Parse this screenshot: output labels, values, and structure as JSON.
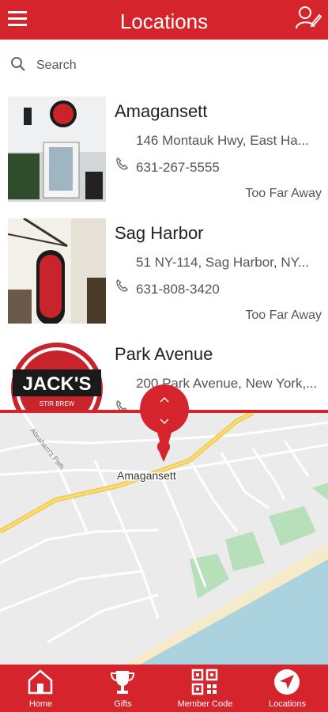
{
  "header": {
    "title": "Locations"
  },
  "search": {
    "placeholder": "Search"
  },
  "locations": [
    {
      "name": "Amagansett",
      "address": "146 Montauk Hwy, East Ha...",
      "phone": "631-267-5555",
      "distance": "Too Far Away"
    },
    {
      "name": "Sag Harbor",
      "address": "51 NY-114, Sag Harbor, NY...",
      "phone": "631-808-3420",
      "distance": "Too Far Away"
    },
    {
      "name": "Park Avenue",
      "address": "200 Park Avenue, New York,...",
      "phone": "",
      "distance": ""
    }
  ],
  "thumb_text": {
    "logo": "JACK'S",
    "sub": "STIR BREW"
  },
  "map": {
    "place_label": "Amagansett",
    "street_label": "Abraham's Path"
  },
  "tabs": [
    {
      "label": "Home",
      "icon": "home-icon"
    },
    {
      "label": "Gifts",
      "icon": "trophy-icon"
    },
    {
      "label": "Member Code",
      "icon": "qr-code-icon"
    },
    {
      "label": "Locations",
      "icon": "navigation-icon"
    }
  ],
  "colors": {
    "brand": "#d6242c",
    "road_major": "#f2c94c",
    "park": "#b7dfb9",
    "water": "#aad3df"
  }
}
